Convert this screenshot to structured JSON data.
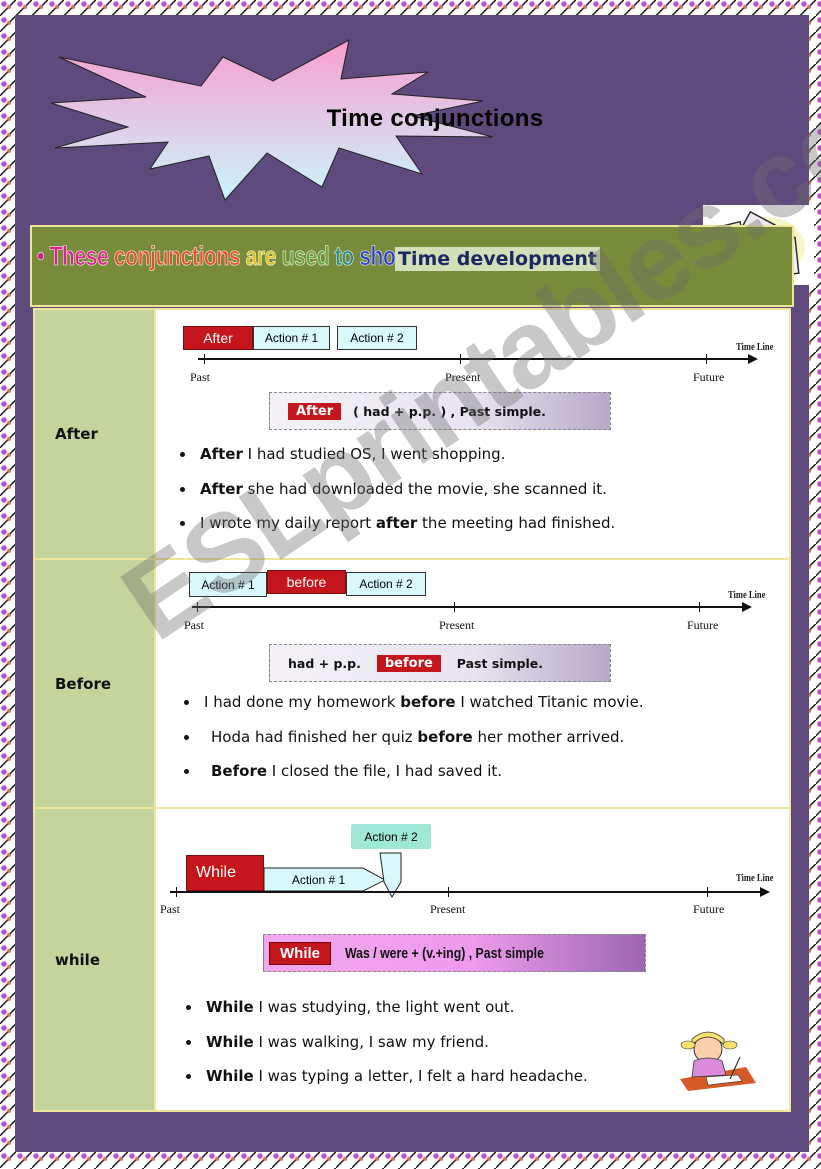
{
  "title": "Time conjunctions",
  "header": {
    "intro_words": [
      "•",
      "These",
      "conjunctions",
      "are",
      "used",
      "to",
      "show"
    ],
    "intro_colors": [
      "#d01e8c",
      "#e0208c",
      "#e4502a",
      "#d8c21a",
      "#6aa53c",
      "#2a8f8a",
      "#2c3fd0",
      "#7a2bc0"
    ],
    "highlight": "Time development"
  },
  "timeline_labels": {
    "past": "Past",
    "present": "Present",
    "future": "Future",
    "title": "Time Line"
  },
  "sections": [
    {
      "label": "After",
      "boxes": [
        "After",
        "Action # 1",
        "Action # 2"
      ],
      "formula": {
        "tag": "After",
        "text": "( had + p.p. ) , Past simple."
      },
      "examples": [
        {
          "bold_prefix": "After",
          "text": " I had studied OS, I went shopping.",
          "bold_mid": "",
          "suffix": ""
        },
        {
          "bold_prefix": "After",
          "text": " she had downloaded the movie, she scanned it.",
          "bold_mid": "",
          "suffix": ""
        },
        {
          "bold_prefix": "",
          "text": "I wrote my daily report ",
          "bold_mid": "after",
          "suffix": " the meeting had finished."
        }
      ]
    },
    {
      "label": "Before",
      "boxes": [
        "Action # 1",
        "before",
        "Action # 2"
      ],
      "formula": {
        "pre": "had + p.p.",
        "tag": "before",
        "text": "Past simple."
      },
      "examples": [
        {
          "bold_prefix": "",
          "text": "I had done my homework ",
          "bold_mid": "before",
          "suffix": " I watched Titanic movie."
        },
        {
          "bold_prefix": "",
          "text": "Hoda had finished her quiz ",
          "bold_mid": "before",
          "suffix": " her mother arrived."
        },
        {
          "bold_prefix": "Before",
          "text": " I closed the file, I had saved it.",
          "bold_mid": "",
          "suffix": ""
        }
      ]
    },
    {
      "label": "while",
      "boxes": [
        "While",
        "Action # 1",
        "Action # 2"
      ],
      "formula": {
        "tag": "While",
        "text": "Was / were + (v.+ing) , Past simple"
      },
      "examples": [
        {
          "bold_prefix": "While",
          "text": " I was studying, the light went out.",
          "bold_mid": "",
          "suffix": ""
        },
        {
          "bold_prefix": "While",
          "text": " I was walking, I saw my friend.",
          "bold_mid": "",
          "suffix": ""
        },
        {
          "bold_prefix": "While",
          "text": " I was typing a letter, I felt a hard headache.",
          "bold_mid": "",
          "suffix": ""
        }
      ]
    }
  ],
  "watermark": "ESLprintables.com",
  "images": {
    "calendar": "calendar-321-icon",
    "kid": "girl-writing-illustration"
  }
}
